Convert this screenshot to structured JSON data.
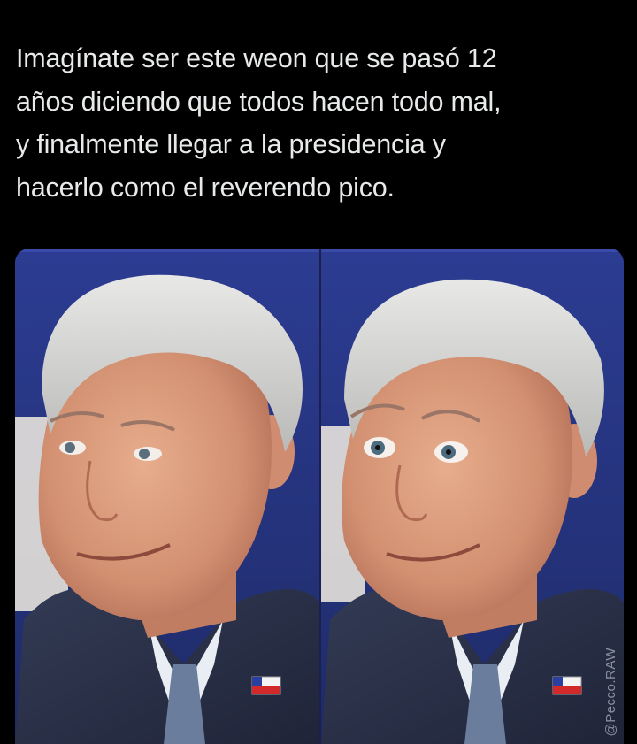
{
  "tweet": {
    "lines": [
      "Imagínate ser este weon que se pasó 12",
      "años diciendo que todos hacen todo mal,",
      "y finalmente llegar a la presidencia y",
      "hacerlo como el reverendo pico."
    ]
  },
  "media": {
    "panels": [
      {
        "subject": "man-smirking-side-glance"
      },
      {
        "subject": "man-smirking-wide-eyes"
      }
    ],
    "watermark": "@Pecco.RAW"
  },
  "colors": {
    "background": "#000000",
    "text": "#e7e9ea",
    "backdrop_blue": "#2a3a8c",
    "hair": "#cfcfcf",
    "skin": "#d99a7a",
    "suit": "#2a3148"
  }
}
